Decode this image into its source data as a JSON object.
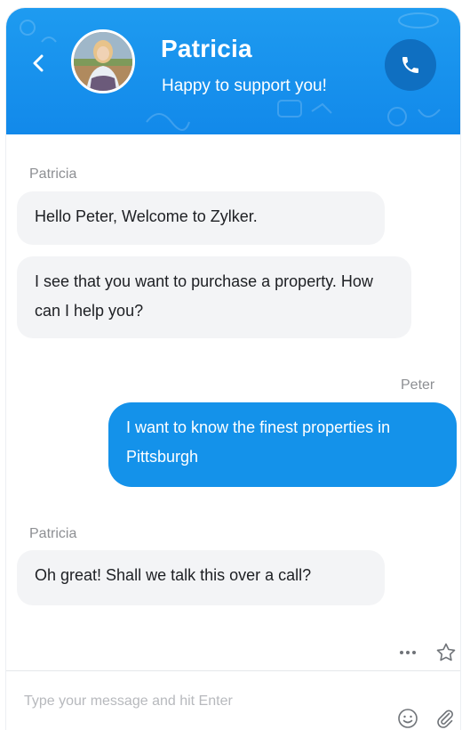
{
  "header": {
    "name": "Patricia",
    "status": "Happy to support you!",
    "back_icon": "chevron-left-icon",
    "call_icon": "phone-icon"
  },
  "messages": [
    {
      "sender": "Patricia",
      "text": "Hello Peter, Welcome to Zylker.",
      "direction": "incoming"
    },
    {
      "sender": "Patricia",
      "text": "I see that you want to purchase a property. How can I help you?",
      "direction": "incoming"
    },
    {
      "sender": "Peter",
      "text": "I want to know the finest properties in Pittsburgh",
      "direction": "outgoing"
    },
    {
      "sender": "Patricia",
      "text": "Oh great! Shall we talk this over a call?",
      "direction": "incoming"
    }
  ],
  "composer": {
    "placeholder": "Type your message and hit Enter",
    "more_icon": "more-dots-icon",
    "star_icon": "star-icon",
    "emoji_icon": "smiley-icon",
    "attach_icon": "paperclip-icon"
  },
  "colors": {
    "header": "#1e9bf0",
    "call_button": "#0f6fc1",
    "outgoing_bubble": "#1492ea",
    "incoming_bubble": "#f3f4f6"
  }
}
